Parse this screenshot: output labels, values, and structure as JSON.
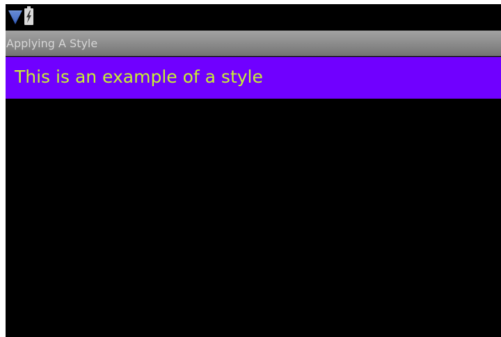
{
  "status_bar": {
    "wifi_icon": "wifi-signal-icon",
    "battery_icon": "battery-charging-icon"
  },
  "title_bar": {
    "title": "Applying A Style"
  },
  "content": {
    "styled_text": "This is an example of a style"
  },
  "colors": {
    "styled_background": "#7000ff",
    "styled_text": "#c8f033",
    "title_text": "#d6d6d6",
    "screen_background": "#000000"
  }
}
